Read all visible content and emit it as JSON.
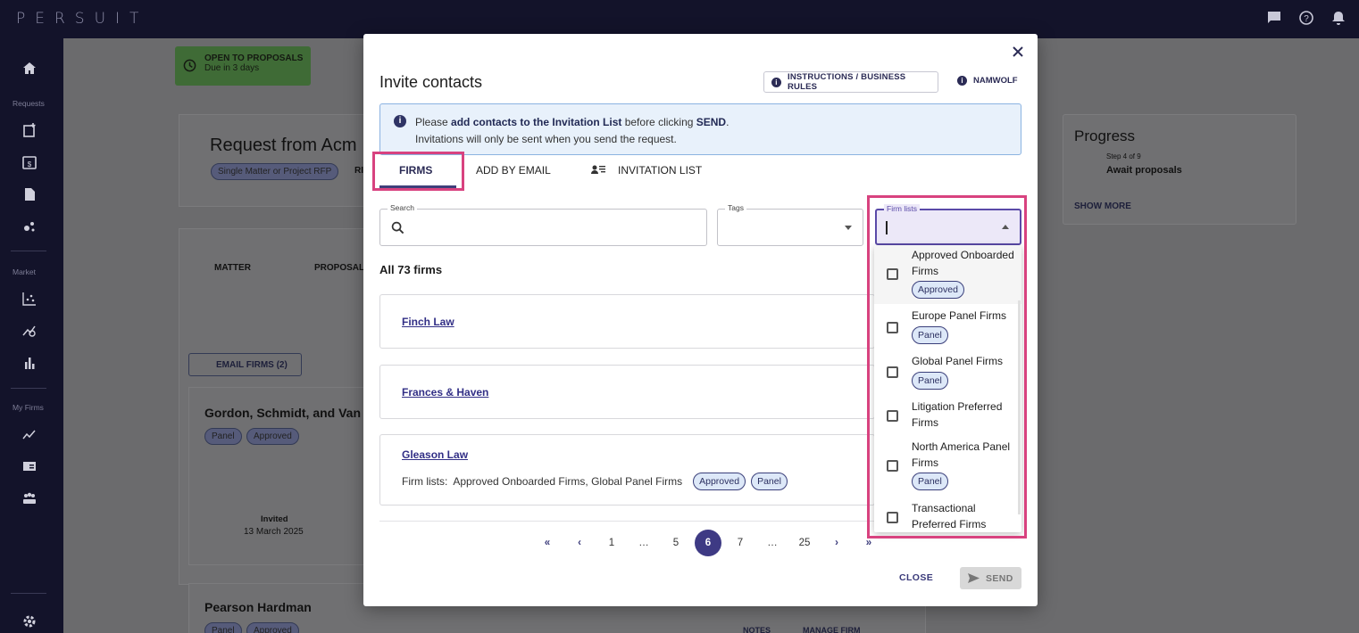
{
  "app": {
    "logo": "PERSUIT"
  },
  "sidebar": {
    "sections": [
      "Requests",
      "Market",
      "My Firms"
    ]
  },
  "background": {
    "badge": {
      "title": "OPEN TO PROPOSALS",
      "subtitle": "Due in 3 days"
    },
    "request_title": "Request from Acm",
    "chips": [
      "Single Matter or Project RFP",
      "RI"
    ],
    "tabs": [
      "MATTER",
      "PROPOSAL"
    ],
    "email_firms": "EMAIL FIRMS (2)",
    "firm1": {
      "name": "Gordon, Schmidt, and Van",
      "chips": [
        "Panel",
        "Approved"
      ],
      "status": "Invited",
      "date": "13 March 2025"
    },
    "firm2": {
      "name": "Pearson Hardman",
      "chips": [
        "Panel",
        "Approved"
      ],
      "notes": "NOTES",
      "manage": "MANAGE FIRM"
    },
    "progress": {
      "title": "Progress",
      "step": "Step 4 of 9",
      "stage": "Await proposals",
      "show_more": "SHOW MORE"
    }
  },
  "modal": {
    "title": "Invite contacts",
    "instructions_button": "INSTRUCTIONS / BUSINESS RULES",
    "namwolf": "NAMWOLF",
    "info": {
      "pre": "Please ",
      "bold1": "add contacts to the Invitation List",
      "mid": " before clicking ",
      "bold2": "SEND",
      "end": ".",
      "line2": "Invitations will only be sent when you send the request."
    },
    "tabs": {
      "firms": "FIRMS",
      "add_by_email": "ADD BY EMAIL",
      "invitation_list": "INVITATION LIST"
    },
    "filters": {
      "search_label": "Search",
      "tags_label": "Tags",
      "firm_lists_label": "Firm lists"
    },
    "count_label": "All 73 firms",
    "firms": [
      {
        "name": "Finch Law"
      },
      {
        "name": "Frances & Haven"
      },
      {
        "name": "Gleason Law",
        "lists_label": "Firm lists:",
        "lists": "Approved Onboarded Firms,  Global Panel Firms",
        "chips": [
          "Approved",
          "Panel"
        ]
      }
    ],
    "pagination": {
      "first": "«",
      "prev": "‹",
      "pages": [
        "1",
        "…",
        "5",
        "6",
        "7",
        "…",
        "25"
      ],
      "current": "6",
      "next": "›",
      "last": "»"
    },
    "close_label": "CLOSE",
    "send_label": "SEND"
  },
  "firm_list_options": [
    {
      "label": "Approved Onboarded Firms",
      "chip": "Approved",
      "checked": false
    },
    {
      "label": "Europe Panel Firms",
      "chip": "Panel",
      "checked": false
    },
    {
      "label": "Global Panel Firms",
      "chip": "Panel",
      "checked": false
    },
    {
      "label": "Litigation Preferred Firms",
      "chip": "",
      "checked": false
    },
    {
      "label": "North America Panel Firms",
      "chip": "Panel",
      "checked": false
    },
    {
      "label": "Transactional Preferred Firms",
      "chip": "",
      "checked": false
    }
  ],
  "colors": {
    "accent": "#3e3a84",
    "highlight": "#d8427f",
    "topbar": "#13132a"
  }
}
